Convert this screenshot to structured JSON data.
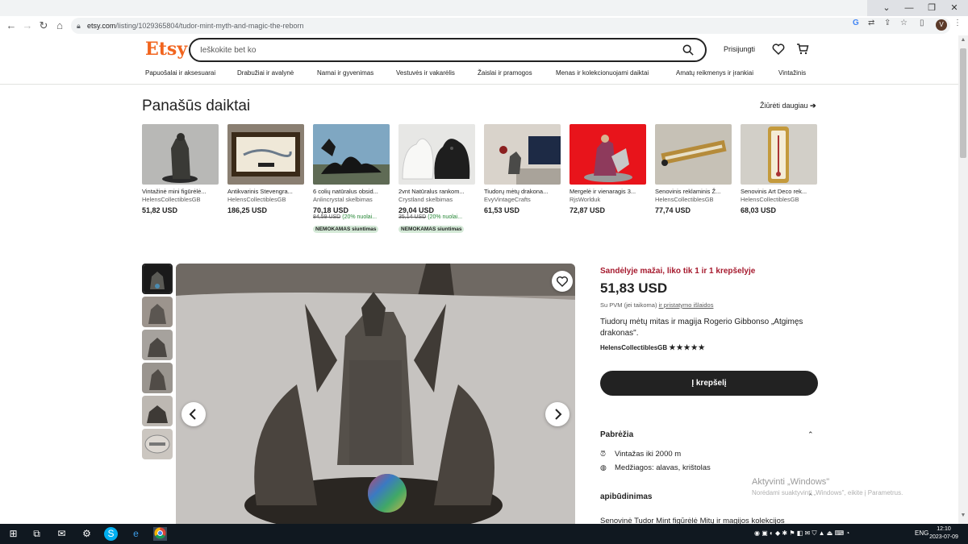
{
  "browser": {
    "url_domain": "etsy.com",
    "url_path": "/listing/1029365804/tudor-mint-myth-and-magic-the-reborn",
    "avatar_letter": "V"
  },
  "header": {
    "logo": "Etsy",
    "search_placeholder": "Ieškokite bet ko",
    "signin": "Prisijungti",
    "accent": "#f1641e"
  },
  "categories": [
    "Papuošalai ir aksesuarai",
    "Drabužiai ir avalynė",
    "Namai ir gyvenimas",
    "Vestuvės ir vakarėlis",
    "Žaislai ir pramogos",
    "Menas ir kolekcionuojami daiktai",
    "Amatų reikmenys ir įrankiai",
    "Vintažinis"
  ],
  "similar": {
    "title": "Panašūs daiktai",
    "see_more": "Žiūrėti daugiau",
    "items": [
      {
        "name": "Vintažinė mini figūrėlė...",
        "shop": "HelensCollectiblesGB",
        "price": "51,82 USD"
      },
      {
        "name": "Antikvarinis Stevengra...",
        "shop": "HelensCollectiblesGB",
        "price": "186,25 USD"
      },
      {
        "name": "6 colių natūralus obsid...",
        "shop": "Anlincrystal skelbimas",
        "price": "70,18 USD",
        "old": "84,59 USD",
        "pct": "(20% nuolai...",
        "free": "NEMOKAMAS siuntimas"
      },
      {
        "name": "2vnt Natūralus rankom...",
        "shop": "Crystland skelbimas",
        "price": "29,04 USD",
        "old": "35,14 USD",
        "pct": "(20% nuolai...",
        "free": "NEMOKAMAS siuntimas"
      },
      {
        "name": "Tiudorų mėtų drakona...",
        "shop": "EvyVintageCrafts",
        "price": "61,53 USD"
      },
      {
        "name": "Mergelė ir vienaragis 3...",
        "shop": "RjsWorlduk",
        "price": "72,87 USD"
      },
      {
        "name": "Senovinis reklaminis Ž...",
        "shop": "HelensCollectiblesGB",
        "price": "77,74 USD"
      },
      {
        "name": "Senovinis Art Deco rek...",
        "shop": "HelensCollectiblesGB",
        "price": "68,03 USD"
      }
    ]
  },
  "product": {
    "stock": "Sandėlyje mažai, liko tik 1 ir 1 krepšelyje",
    "price": "51,83 USD",
    "vat": "Su PVM (jei taikoma)",
    "shipping_link": "ir pristatymo išlaidos",
    "title": "Tiudorų mėtų mitas ir magija Rogerio Gibbonso „Atgimęs drakonas\".",
    "seller": "HelensCollectiblesGB",
    "stars": "★★★★★",
    "add_to_cart": "Į krepšelį",
    "highlights_title": "Pabrėžia",
    "highlights": [
      "Vintažas iki 2000 m",
      "Medžiagos: alavas, krištolas"
    ],
    "description_title": "apibūdinimas",
    "description_preview": "Senovinė Tudor Mint figūrėlė Mitų ir magijos kolekcijos"
  },
  "windows": {
    "watermark_title": "Aktyvinti „Windows\"",
    "watermark_sub": "Norėdami suaktyvinti „Windows\", eikite į Parametrus.",
    "lang": "ENG",
    "time": "12:10",
    "date": "2023-07-09"
  }
}
